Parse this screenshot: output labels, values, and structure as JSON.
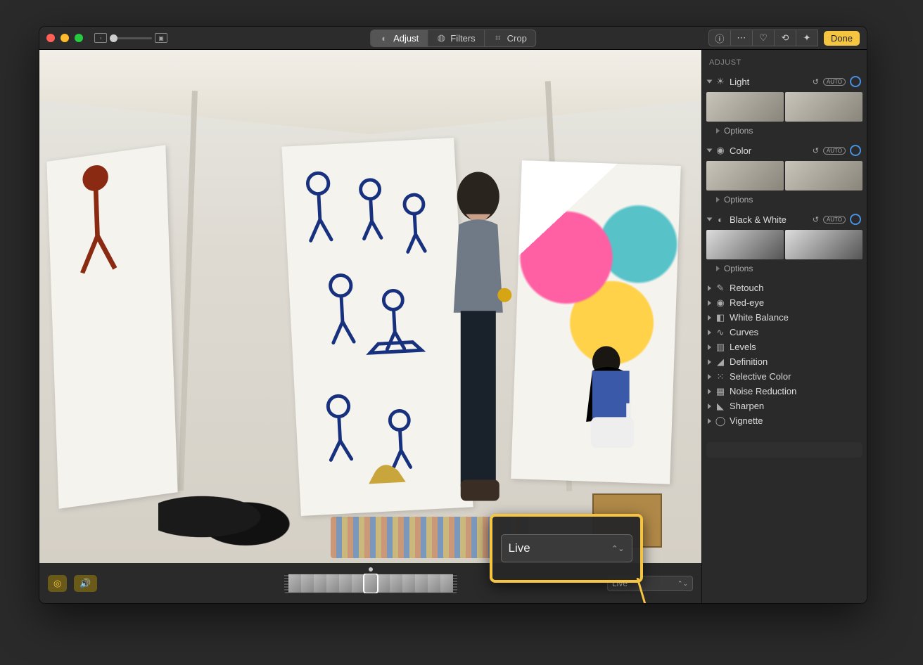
{
  "toolbar": {
    "tabs": {
      "adjust": "Adjust",
      "filters": "Filters",
      "crop": "Crop"
    },
    "done": "Done"
  },
  "bottom": {
    "live_select": "Live"
  },
  "callout": {
    "label": "Live"
  },
  "sidebar": {
    "title": "ADJUST",
    "auto": "AUTO",
    "options": "Options",
    "sections": {
      "light": "Light",
      "color": "Color",
      "bw": "Black & White",
      "retouch": "Retouch",
      "redeye": "Red-eye",
      "wb": "White Balance",
      "curves": "Curves",
      "levels": "Levels",
      "definition": "Definition",
      "selective": "Selective Color",
      "noise": "Noise Reduction",
      "sharpen": "Sharpen",
      "vignette": "Vignette"
    }
  }
}
